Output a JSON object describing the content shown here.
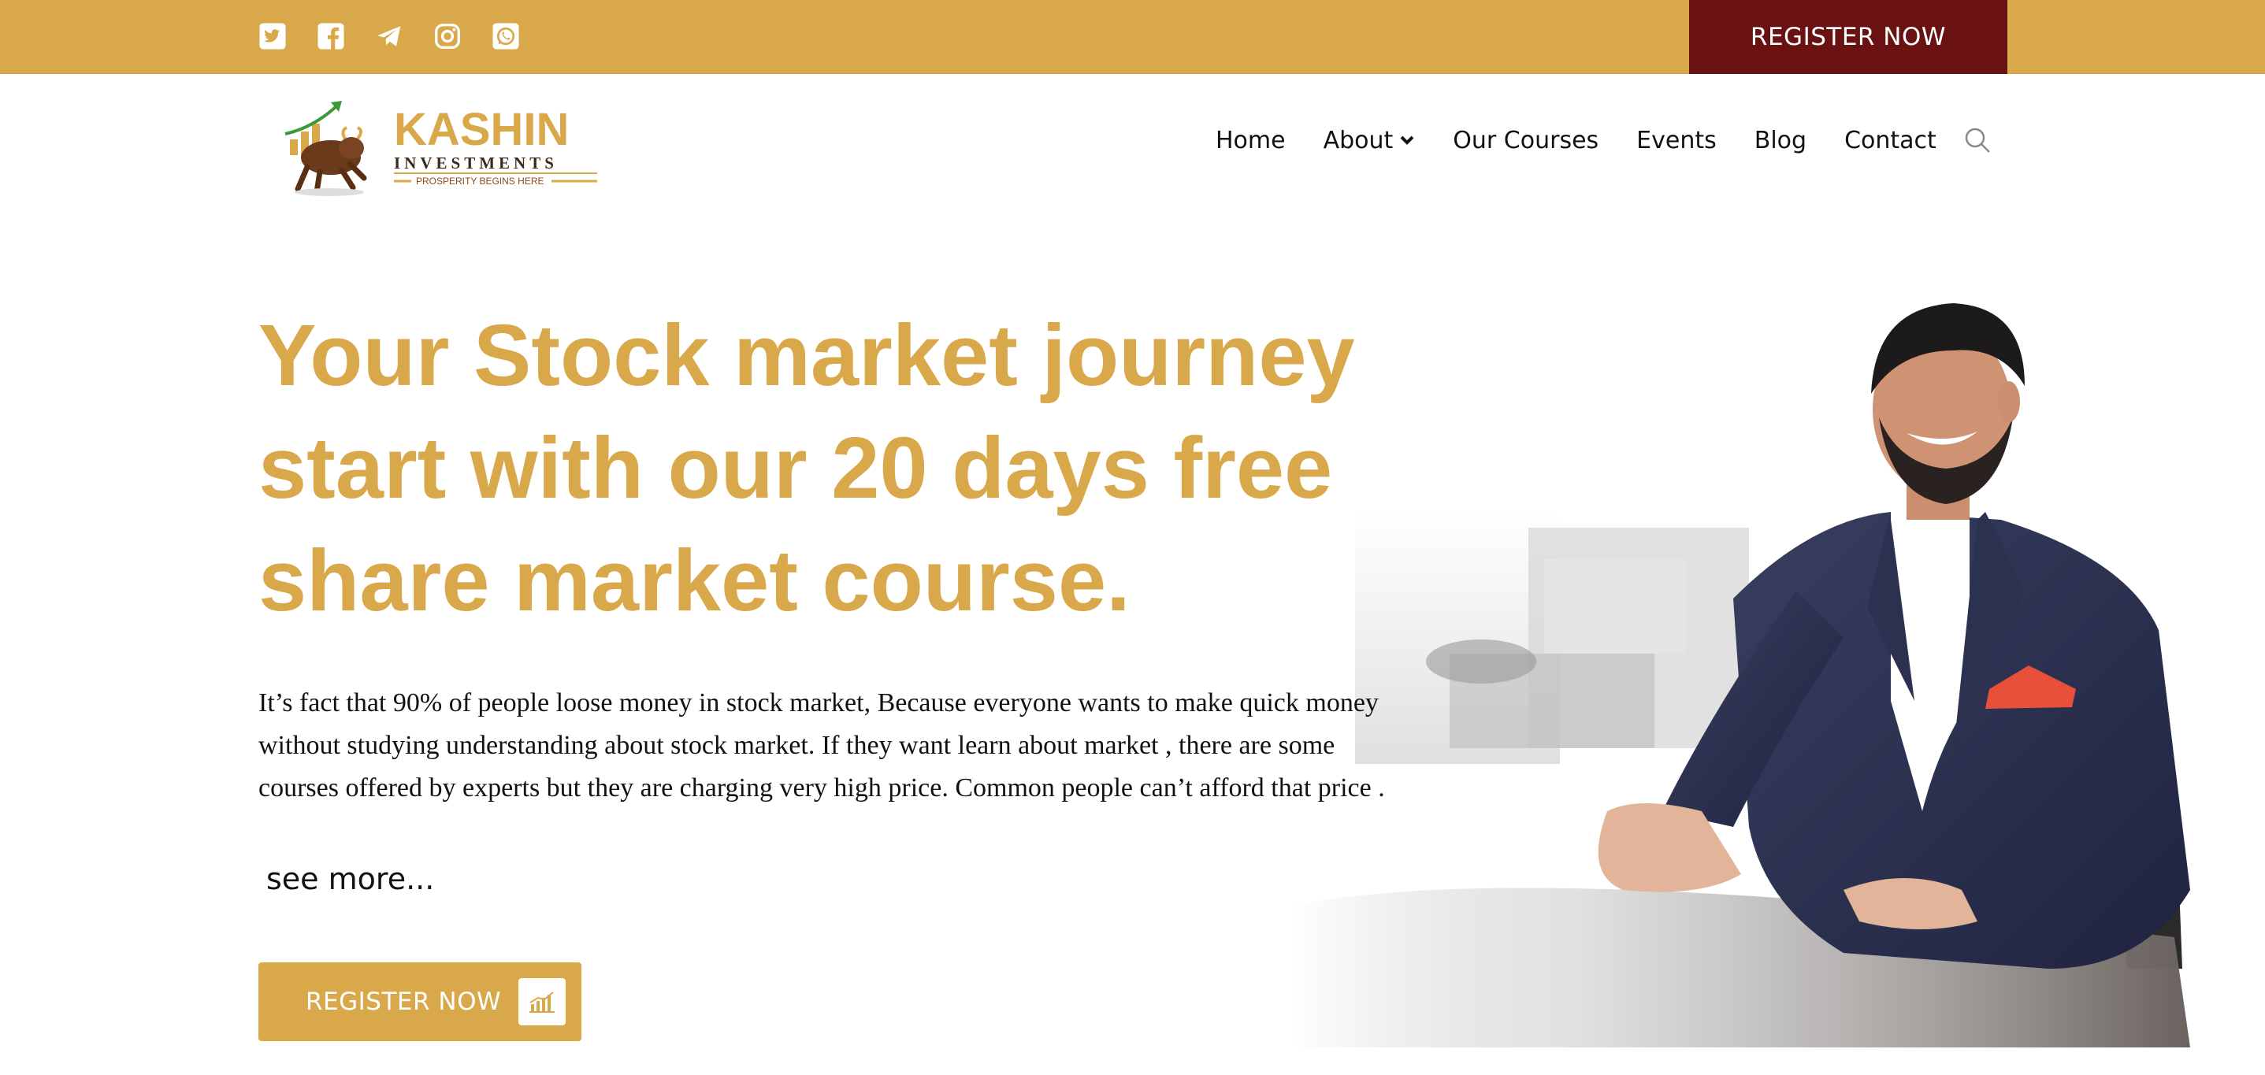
{
  "topbar": {
    "social_icons": [
      "twitter-icon",
      "facebook-icon",
      "telegram-icon",
      "instagram-icon",
      "whatsapp-icon"
    ],
    "register_label": "REGISTER NOW"
  },
  "logo": {
    "name": "KASHIN",
    "subtitle": "INVESTMENTS",
    "tagline": "PROSPERITY BEGINS HERE"
  },
  "nav": {
    "items": [
      {
        "label": "Home"
      },
      {
        "label": "About"
      },
      {
        "label": "Our Courses"
      },
      {
        "label": "Events"
      },
      {
        "label": "Blog"
      },
      {
        "label": "Contact"
      }
    ],
    "search_icon": "search-icon"
  },
  "hero": {
    "title": "Your Stock market journey start with our 20 days free share market course.",
    "description": "It’s fact that 90% of people loose money in stock market, Because everyone wants to make quick money without studying understanding about stock market. If they want learn about market , there are some courses offered by experts but they are charging very high price. Common people can’t afford that price .",
    "see_more": "see more...",
    "register_label": "REGISTER NOW",
    "register_icon": "chart-growth-icon"
  },
  "colors": {
    "gold": "#d9a84a",
    "maroon": "#6a1212",
    "text": "#111111"
  }
}
